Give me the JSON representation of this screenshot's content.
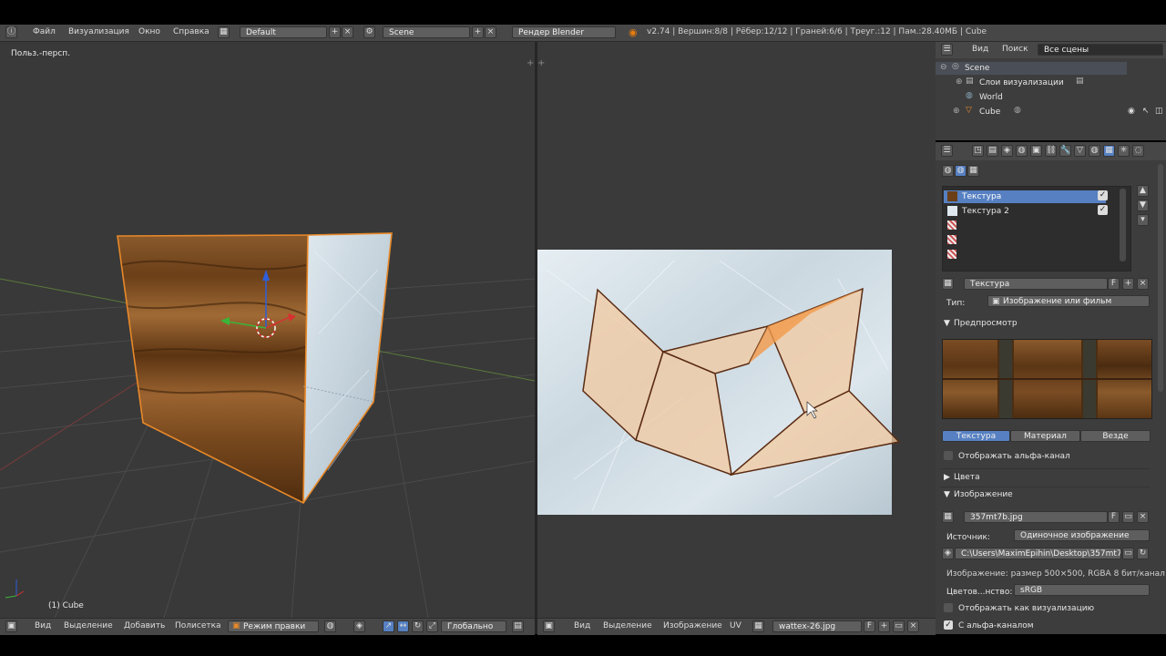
{
  "topbar": {
    "menu": [
      "Файл",
      "Визуализация",
      "Окно",
      "Справка"
    ],
    "layout": "Default",
    "scene": "Scene",
    "engine": "Рендер Blender",
    "stats": "v2.74 | Вершин:8/8 | Рёбер:12/12 | Граней:6/6 | Треуг.:12 | Пам.:28.40МБ | Cube"
  },
  "viewport3d": {
    "label": "Польз.-персп.",
    "object": "(1) Cube",
    "footer": {
      "menu": [
        "Вид",
        "Выделение",
        "Добавить",
        "Полисетка"
      ],
      "mode": "Режим правки",
      "orientation": "Глобально"
    }
  },
  "uv_editor": {
    "footer": {
      "menu": [
        "Вид",
        "Выделение",
        "Изображение",
        "UV"
      ],
      "image": "wattex-26.jpg",
      "f_label": "F"
    }
  },
  "outliner": {
    "view": "Вид",
    "search": "Поиск",
    "filter": "Все сцены",
    "items": [
      "Scene",
      "Слои визуализации",
      "World",
      "Cube"
    ]
  },
  "properties": {
    "texture_slots": [
      "Текстура",
      "Текстура 2"
    ],
    "texture_name": "Текстура",
    "f_label": "F",
    "type_label": "Тип:",
    "type_value": "Изображение или фильм",
    "preview_header": "Предпросмотр",
    "preview_tabs": [
      "Текстура",
      "Материал",
      "Везде"
    ],
    "show_alpha": "Отображать альфа-канал",
    "colors_header": "Цвета",
    "image_header": "Изображение",
    "image_name": "357mt7b.jpg",
    "source_label": "Источник:",
    "source_value": "Одиночное изображение",
    "filepath": "C:\\Users\\MaximEpihin\\Desktop\\357mt7b...",
    "image_info": "Изображение: размер 500×500, RGBA 8 бит/канал",
    "colorspace_label": "Цветов...нство:",
    "colorspace_value": "sRGB",
    "show_as_render": "Отображать как визуализацию",
    "with_alpha": "С альфа-каналом"
  },
  "colors": {
    "accent_blue": "#5680c2",
    "edge_orange": "#e8892a",
    "ui_bg": "#474747",
    "viewport_bg": "#393939"
  }
}
